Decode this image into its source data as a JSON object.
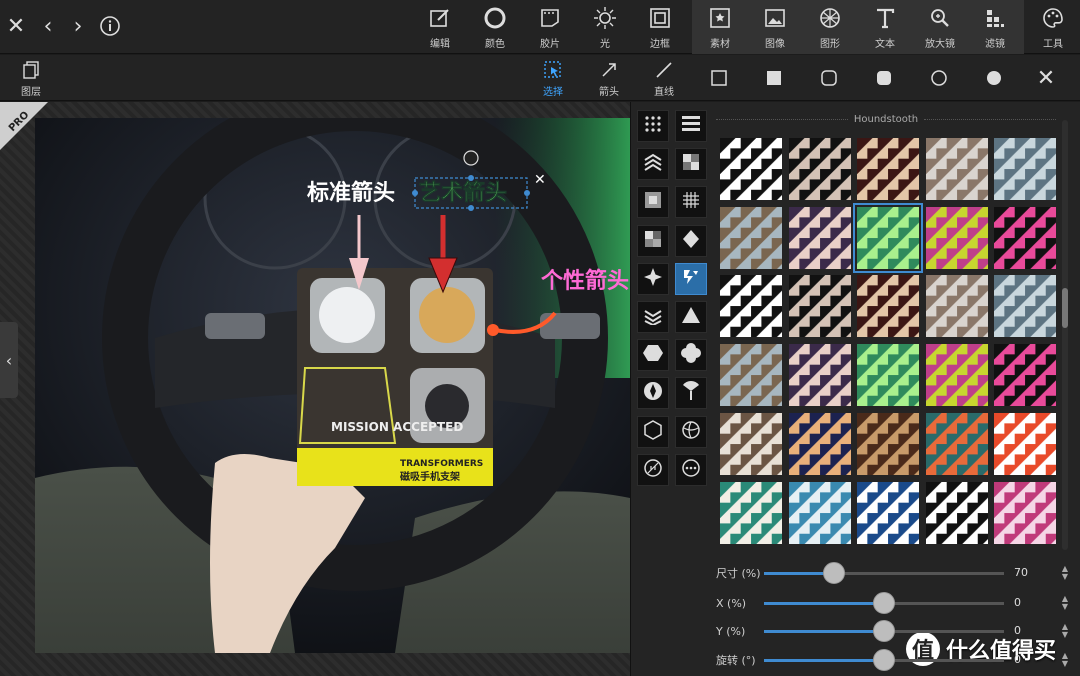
{
  "top_toolbar": {
    "tools": [
      {
        "id": "edit",
        "label": "编辑"
      },
      {
        "id": "color",
        "label": "颜色"
      },
      {
        "id": "film",
        "label": "胶片"
      },
      {
        "id": "light",
        "label": "光"
      },
      {
        "id": "border",
        "label": "边框"
      },
      {
        "id": "material",
        "label": "素材"
      },
      {
        "id": "image",
        "label": "图像"
      },
      {
        "id": "shape",
        "label": "图形"
      },
      {
        "id": "text",
        "label": "文本"
      },
      {
        "id": "magnifier",
        "label": "放大镜"
      },
      {
        "id": "filter",
        "label": "滤镜"
      },
      {
        "id": "utility",
        "label": "工具"
      }
    ]
  },
  "sub_toolbar": {
    "layers_label": "图层",
    "select_label": "选择",
    "arrow_label": "箭头",
    "line_label": "直线"
  },
  "canvas": {
    "pro_badge": "PRO",
    "text_standard_arrow": "标准箭头",
    "text_art_arrow": "艺术箭头",
    "text_custom_arrow": "个性箭头",
    "package_mission": "MISSION ACCEPTED",
    "package_brand": "TRANSFORMERS",
    "package_product": "磁吸手机支架"
  },
  "panel": {
    "section_title": "Houndstooth",
    "swatches": [
      {
        "fg": "#111111",
        "bg": "#ffffff"
      },
      {
        "fg": "#111111",
        "bg": "#d4c2b6"
      },
      {
        "fg": "#3b1614",
        "bg": "#e3c6a8"
      },
      {
        "fg": "#8a7769",
        "bg": "#d9d4cf"
      },
      {
        "fg": "#5d7482",
        "bg": "#c9d7dd"
      },
      {
        "fg": "#7a6650",
        "bg": "#a7b7c0"
      },
      {
        "fg": "#3b2a4a",
        "bg": "#e9d0c8"
      },
      {
        "fg": "#2f8a5c",
        "bg": "#a9f08d"
      },
      {
        "fg": "#bf3f8a",
        "bg": "#c7d62f"
      },
      {
        "fg": "#111111",
        "bg": "#e94a9a"
      },
      {
        "fg": "#111111",
        "bg": "#ffffff"
      },
      {
        "fg": "#111111",
        "bg": "#d4c2b6"
      },
      {
        "fg": "#3b1614",
        "bg": "#e3c6a8"
      },
      {
        "fg": "#8a7769",
        "bg": "#d9d4cf"
      },
      {
        "fg": "#5d7482",
        "bg": "#c9d7dd"
      },
      {
        "fg": "#7a6650",
        "bg": "#a7b7c0"
      },
      {
        "fg": "#3b2a4a",
        "bg": "#e9d0c8"
      },
      {
        "fg": "#2f8a5c",
        "bg": "#a9f08d"
      },
      {
        "fg": "#bf3f8a",
        "bg": "#c7d62f"
      },
      {
        "fg": "#111111",
        "bg": "#e94a9a"
      },
      {
        "fg": "#6b5544",
        "bg": "#e8e0d6"
      },
      {
        "fg": "#1c2250",
        "bg": "#e9b07a"
      },
      {
        "fg": "#4a2a1a",
        "bg": "#c89b6a"
      },
      {
        "fg": "#2a6b6a",
        "bg": "#e86a3a"
      },
      {
        "fg": "#e84a2a",
        "bg": "#ffffff"
      },
      {
        "fg": "#2a8a78",
        "bg": "#f2efe6"
      },
      {
        "fg": "#3a8ab0",
        "bg": "#e6f0f4"
      },
      {
        "fg": "#1a4a8a",
        "bg": "#ffffff"
      },
      {
        "fg": "#111111",
        "bg": "#ffffff"
      },
      {
        "fg": "#c03a7a",
        "bg": "#f5d6e6"
      }
    ],
    "selected_swatch": 7,
    "sliders": [
      {
        "label": "尺寸 (%)",
        "value": "70",
        "level": 0.29
      },
      {
        "label": "X (%)",
        "value": "0",
        "level": 0.5
      },
      {
        "label": "Y (%)",
        "value": "0",
        "level": 0.5
      },
      {
        "label": "旋转 (°)",
        "value": "0",
        "level": 0.5
      }
    ]
  },
  "watermark": {
    "logo": "值",
    "text": "什么值得买"
  }
}
